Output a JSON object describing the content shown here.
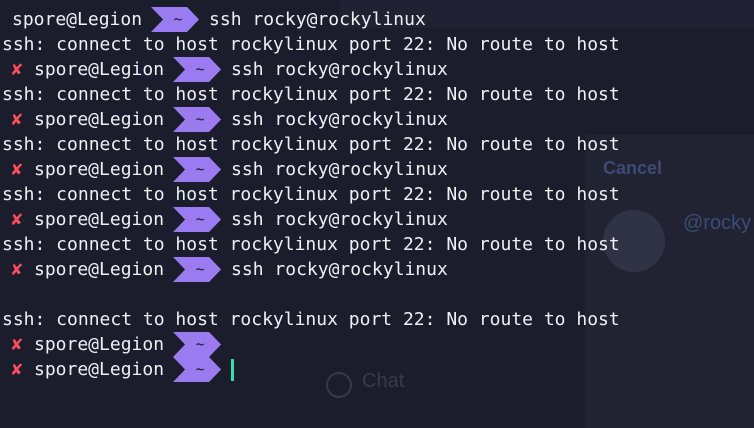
{
  "terminal": {
    "prompt_user": "spore@Legion",
    "prompt_dir": "~",
    "fail_mark": "✘",
    "command": "ssh rocky@rockylinux",
    "error": "ssh: connect to host rockylinux port 22: No route to host"
  },
  "background_window": {
    "cancel_label": "Cancel",
    "user_label": "@rocky",
    "chat_label": "Chat"
  },
  "colors": {
    "background": "#1c1d2c",
    "prompt_segment": "#9a7cf0",
    "fail_mark": "#ff4d5a",
    "cursor": "#2fe0a8",
    "text": "#eef0f6"
  }
}
